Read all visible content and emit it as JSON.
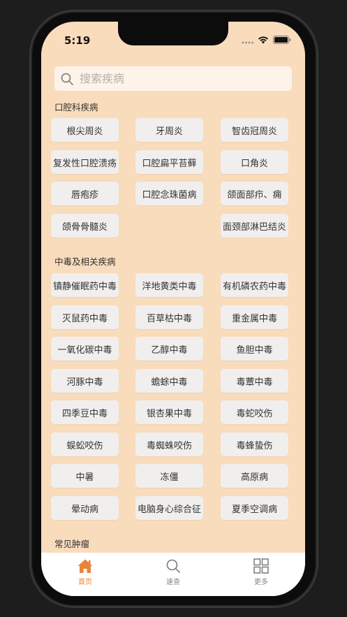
{
  "status": {
    "time": "5:19"
  },
  "search": {
    "placeholder": "搜索疾病"
  },
  "sections": [
    {
      "title": "口腔科疾病",
      "items": [
        "根尖周炎",
        "牙周炎",
        "智齿冠周炎",
        "复发性口腔溃疡",
        "口腔扁平苔藓",
        "口角炎",
        "唇疱疹",
        "口腔念珠菌病",
        "颌面部疖、痈",
        "颌骨骨髓炎",
        "",
        "面颈部淋巴结炎"
      ]
    },
    {
      "title": "中毒及相关疾病",
      "items": [
        "镇静催眠药中毒",
        "洋地黄类中毒",
        "有机磷农药中毒",
        "灭鼠药中毒",
        "百草枯中毒",
        "重金属中毒",
        "一氧化碳中毒",
        "乙醇中毒",
        "鱼胆中毒",
        "河豚中毒",
        "蟾蜍中毒",
        "毒蕈中毒",
        "四季豆中毒",
        "银杏果中毒",
        "毒蛇咬伤",
        "蜈蚣咬伤",
        "毒蜘蛛咬伤",
        "毒蜂蛰伤",
        "中暑",
        "冻僵",
        "高原病",
        "晕动病",
        "电脑身心综合征",
        "夏季空调病"
      ]
    },
    {
      "title": "常见肿瘤",
      "items": []
    }
  ],
  "tabbar": {
    "items": [
      {
        "label": "首页",
        "icon": "home-icon",
        "active": true
      },
      {
        "label": "速查",
        "icon": "search-icon",
        "active": false
      },
      {
        "label": "更多",
        "icon": "grid-icon",
        "active": false
      }
    ]
  },
  "colors": {
    "background": "#f9dcbc",
    "accent": "#e8833a",
    "chip": "#f0efee"
  }
}
